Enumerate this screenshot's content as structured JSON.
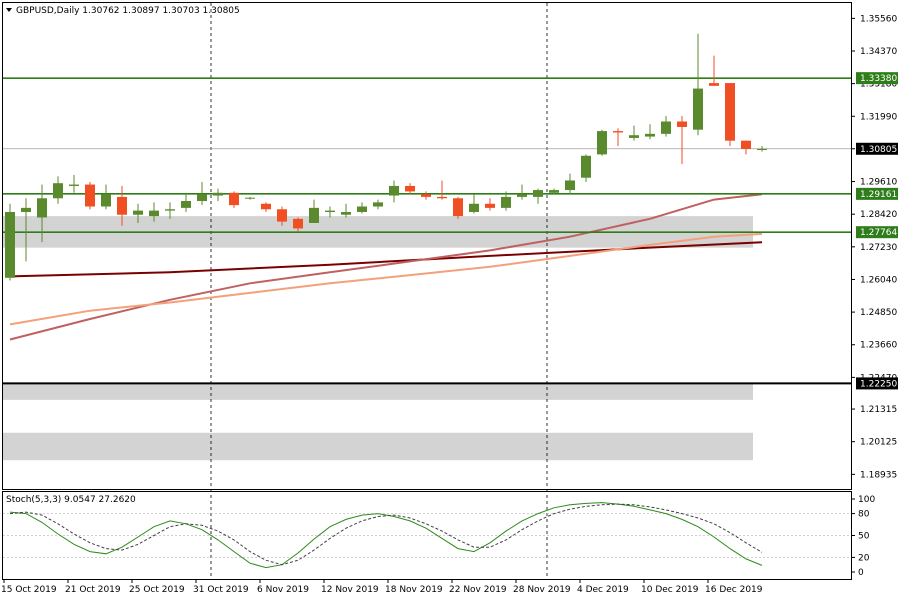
{
  "header": {
    "symbol_line": "GBPUSD,Daily  1.30762 1.30897 1.30703 1.30805"
  },
  "stoch_label": "Stoch(5,3,3) 9.0547 27.2620",
  "colors": {
    "bull": "#5a8a2e",
    "bear": "#f04e23",
    "hline": "#2e7d1a",
    "ma_slow": "#7a0000",
    "ma_mid": "#c06060",
    "ma_fast": "#f4a07a",
    "stoch_main": "#2e8b1a",
    "stoch_signal": "#404040",
    "zone": "#d3d3d3"
  },
  "chart_data": {
    "type": "candlestick",
    "price_axis": {
      "ylim": [
        1.184,
        1.3612
      ],
      "ticks": [
        "1.35560",
        "1.34370",
        "1.33180",
        "1.31990",
        "1.30805",
        "1.29610",
        "1.28420",
        "1.27230",
        "1.26040",
        "1.24850",
        "1.23660",
        "1.22470",
        "1.21315",
        "1.20125",
        "1.18935"
      ]
    },
    "date_labels": [
      {
        "label": "15 Oct 2019",
        "index": 0
      },
      {
        "label": "21 Oct 2019",
        "index": 4
      },
      {
        "label": "25 Oct 2019",
        "index": 8
      },
      {
        "label": "31 Oct 2019",
        "index": 12
      },
      {
        "label": "6 Nov 2019",
        "index": 16
      },
      {
        "label": "12 Nov 2019",
        "index": 20
      },
      {
        "label": "18 Nov 2019",
        "index": 24
      },
      {
        "label": "22 Nov 2019",
        "index": 28
      },
      {
        "label": "28 Nov 2019",
        "index": 32
      },
      {
        "label": "4 Dec 2019",
        "index": 36
      },
      {
        "label": "10 Dec 2019",
        "index": 40
      },
      {
        "label": "16 Dec 2019",
        "index": 44
      }
    ],
    "separators": [
      13,
      34
    ],
    "candles": [
      {
        "o": 1.261,
        "h": 1.288,
        "l": 1.26,
        "c": 1.285
      },
      {
        "o": 1.285,
        "h": 1.29,
        "l": 1.267,
        "c": 1.2865
      },
      {
        "o": 1.283,
        "h": 1.295,
        "l": 1.274,
        "c": 1.29
      },
      {
        "o": 1.29,
        "h": 1.298,
        "l": 1.288,
        "c": 1.2955
      },
      {
        "o": 1.2945,
        "h": 1.2985,
        "l": 1.292,
        "c": 1.295
      },
      {
        "o": 1.295,
        "h": 1.296,
        "l": 1.286,
        "c": 1.287
      },
      {
        "o": 1.287,
        "h": 1.295,
        "l": 1.286,
        "c": 1.2915
      },
      {
        "o": 1.2905,
        "h": 1.2945,
        "l": 1.28,
        "c": 1.284
      },
      {
        "o": 1.284,
        "h": 1.288,
        "l": 1.281,
        "c": 1.2855
      },
      {
        "o": 1.2835,
        "h": 1.2885,
        "l": 1.2815,
        "c": 1.2855
      },
      {
        "o": 1.2855,
        "h": 1.2885,
        "l": 1.2825,
        "c": 1.286
      },
      {
        "o": 1.2865,
        "h": 1.292,
        "l": 1.285,
        "c": 1.289
      },
      {
        "o": 1.289,
        "h": 1.296,
        "l": 1.2875,
        "c": 1.2915
      },
      {
        "o": 1.291,
        "h": 1.2935,
        "l": 1.289,
        "c": 1.292
      },
      {
        "o": 1.292,
        "h": 1.2925,
        "l": 1.2865,
        "c": 1.2875
      },
      {
        "o": 1.29,
        "h": 1.2905,
        "l": 1.2895,
        "c": 1.2902
      },
      {
        "o": 1.288,
        "h": 1.2885,
        "l": 1.285,
        "c": 1.286
      },
      {
        "o": 1.286,
        "h": 1.287,
        "l": 1.28,
        "c": 1.2815
      },
      {
        "o": 1.2825,
        "h": 1.283,
        "l": 1.278,
        "c": 1.279
      },
      {
        "o": 1.281,
        "h": 1.2895,
        "l": 1.281,
        "c": 1.2865
      },
      {
        "o": 1.285,
        "h": 1.287,
        "l": 1.283,
        "c": 1.2855
      },
      {
        "o": 1.284,
        "h": 1.288,
        "l": 1.283,
        "c": 1.285
      },
      {
        "o": 1.285,
        "h": 1.2885,
        "l": 1.2845,
        "c": 1.287
      },
      {
        "o": 1.287,
        "h": 1.2895,
        "l": 1.286,
        "c": 1.2885
      },
      {
        "o": 1.291,
        "h": 1.2965,
        "l": 1.2885,
        "c": 1.2945
      },
      {
        "o": 1.2945,
        "h": 1.2955,
        "l": 1.2915,
        "c": 1.2925
      },
      {
        "o": 1.2915,
        "h": 1.2925,
        "l": 1.2895,
        "c": 1.2905
      },
      {
        "o": 1.2905,
        "h": 1.2965,
        "l": 1.2895,
        "c": 1.29
      },
      {
        "o": 1.29,
        "h": 1.2905,
        "l": 1.2825,
        "c": 1.2835
      },
      {
        "o": 1.285,
        "h": 1.2915,
        "l": 1.2845,
        "c": 1.288
      },
      {
        "o": 1.288,
        "h": 1.29,
        "l": 1.2855,
        "c": 1.2865
      },
      {
        "o": 1.2865,
        "h": 1.2925,
        "l": 1.2855,
        "c": 1.2905
      },
      {
        "o": 1.2905,
        "h": 1.295,
        "l": 1.2895,
        "c": 1.2915
      },
      {
        "o": 1.2905,
        "h": 1.2935,
        "l": 1.288,
        "c": 1.293
      },
      {
        "o": 1.292,
        "h": 1.2935,
        "l": 1.2915,
        "c": 1.293
      },
      {
        "o": 1.293,
        "h": 1.299,
        "l": 1.2915,
        "c": 1.2965
      },
      {
        "o": 1.2975,
        "h": 1.306,
        "l": 1.296,
        "c": 1.3055
      },
      {
        "o": 1.306,
        "h": 1.315,
        "l": 1.3055,
        "c": 1.3145
      },
      {
        "o": 1.3145,
        "h": 1.3155,
        "l": 1.309,
        "c": 1.314
      },
      {
        "o": 1.312,
        "h": 1.3165,
        "l": 1.311,
        "c": 1.313
      },
      {
        "o": 1.3125,
        "h": 1.317,
        "l": 1.3115,
        "c": 1.3135
      },
      {
        "o": 1.3135,
        "h": 1.32,
        "l": 1.3125,
        "c": 1.318
      },
      {
        "o": 1.318,
        "h": 1.32,
        "l": 1.3025,
        "c": 1.316
      },
      {
        "o": 1.315,
        "h": 1.35,
        "l": 1.313,
        "c": 1.33
      },
      {
        "o": 1.332,
        "h": 1.342,
        "l": 1.331,
        "c": 1.331
      },
      {
        "o": 1.332,
        "h": 1.332,
        "l": 1.309,
        "c": 1.311
      },
      {
        "o": 1.311,
        "h": 1.311,
        "l": 1.306,
        "c": 1.308
      },
      {
        "o": 1.3076,
        "h": 1.309,
        "l": 1.307,
        "c": 1.308
      }
    ],
    "horizontal_lines": [
      {
        "price": 1.3338,
        "label": "1.33380",
        "style": "green"
      },
      {
        "price": 1.30805,
        "label": "1.30805",
        "style": "current"
      },
      {
        "price": 1.29161,
        "label": "1.29161",
        "style": "green"
      },
      {
        "price": 1.27764,
        "label": "1.27764",
        "style": "green"
      },
      {
        "price": 1.2225,
        "label": "1.22250",
        "style": "black"
      }
    ],
    "zones": [
      {
        "from": 1.272,
        "to": 1.2835
      },
      {
        "from": 1.2165,
        "to": 1.2225
      },
      {
        "from": 1.1945,
        "to": 1.2045
      }
    ],
    "moving_averages": [
      {
        "role": "slow",
        "points": [
          [
            0,
            1.2615
          ],
          [
            10,
            1.263
          ],
          [
            20,
            1.2658
          ],
          [
            30,
            1.269
          ],
          [
            40,
            1.272
          ],
          [
            47,
            1.274
          ]
        ]
      },
      {
        "role": "mid",
        "points": [
          [
            0,
            1.2385
          ],
          [
            5,
            1.246
          ],
          [
            10,
            1.253
          ],
          [
            15,
            1.259
          ],
          [
            20,
            1.263
          ],
          [
            25,
            1.267
          ],
          [
            30,
            1.271
          ],
          [
            35,
            1.276
          ],
          [
            40,
            1.2825
          ],
          [
            44,
            1.2895
          ],
          [
            47,
            1.2915
          ]
        ]
      },
      {
        "role": "fast",
        "points": [
          [
            0,
            1.244
          ],
          [
            5,
            1.249
          ],
          [
            10,
            1.252
          ],
          [
            15,
            1.2555
          ],
          [
            20,
            1.259
          ],
          [
            25,
            1.262
          ],
          [
            30,
            1.265
          ],
          [
            35,
            1.269
          ],
          [
            40,
            1.273
          ],
          [
            44,
            1.276
          ],
          [
            47,
            1.277
          ]
        ]
      }
    ],
    "stochastic": {
      "ylim": [
        0,
        100
      ],
      "ticks": [
        100,
        80,
        50,
        20,
        0
      ],
      "main": [
        82,
        80,
        68,
        52,
        38,
        28,
        25,
        34,
        48,
        62,
        70,
        66,
        58,
        44,
        28,
        12,
        6,
        10,
        26,
        45,
        62,
        72,
        78,
        80,
        76,
        70,
        60,
        46,
        32,
        28,
        40,
        56,
        70,
        80,
        88,
        92,
        94,
        95,
        93,
        90,
        85,
        80,
        72,
        62,
        48,
        32,
        18,
        9
      ],
      "signal": [
        80,
        82,
        78,
        66,
        52,
        40,
        32,
        30,
        38,
        50,
        62,
        66,
        64,
        56,
        44,
        28,
        16,
        10,
        16,
        30,
        46,
        60,
        70,
        76,
        78,
        74,
        66,
        56,
        44,
        34,
        34,
        44,
        58,
        70,
        80,
        86,
        90,
        92,
        93,
        92,
        89,
        85,
        80,
        74,
        66,
        54,
        40,
        27
      ]
    }
  }
}
